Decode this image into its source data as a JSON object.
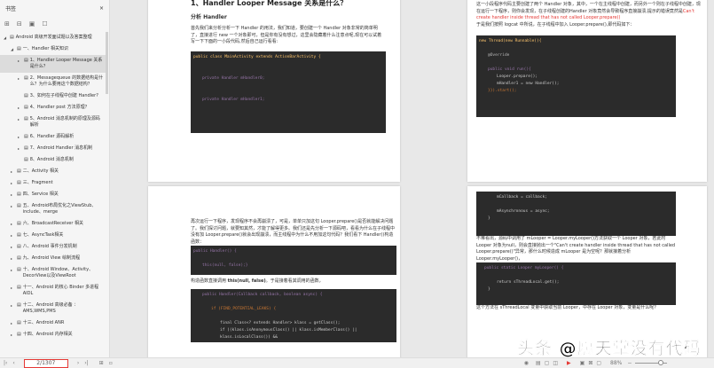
{
  "sidebar": {
    "title": "书签",
    "close": "×",
    "items": [
      {
        "label": "Android 高级开发面试题以及答案整理",
        "level": 0,
        "arrow": "◢"
      },
      {
        "label": "一、Handler 相关知识",
        "level": 1,
        "arrow": "◢"
      },
      {
        "label": "1、Handler Looper Message 关系是什么？",
        "level": 2,
        "arrow": "▸",
        "selected": true
      },
      {
        "label": "2、Messagequeue 的数据结构是什么？为什么要用这个数据结构？",
        "level": 2,
        "arrow": "▸"
      },
      {
        "label": "3、如何在子线程中创建 Handler?",
        "level": 2,
        "arrow": ""
      },
      {
        "label": "4、Handler post 方法原理？",
        "level": 2,
        "arrow": "▸"
      },
      {
        "label": "5、Android 消息机制的原理及源码解析",
        "level": 2,
        "arrow": "▸"
      },
      {
        "label": "6、Handler 源码解析",
        "level": 2,
        "arrow": "▸"
      },
      {
        "label": "7、Android Handler 消息机制",
        "level": 2,
        "arrow": "▸"
      },
      {
        "label": "8、Android 消息机制",
        "level": 2,
        "arrow": ""
      },
      {
        "label": "二、Activity 相关",
        "level": 1,
        "arrow": "▸"
      },
      {
        "label": "三、Fragment",
        "level": 1,
        "arrow": "▸"
      },
      {
        "label": "四、Service 相关",
        "level": 1,
        "arrow": "▸"
      },
      {
        "label": "五、Android布局优化之ViewStub、include、merge",
        "level": 1,
        "arrow": "▸"
      },
      {
        "label": "六、BroadcastReceiver 相关",
        "level": 1,
        "arrow": "▸"
      },
      {
        "label": "七、AsyncTask相关",
        "level": 1,
        "arrow": "▸"
      },
      {
        "label": "八、Android 事件分发机制",
        "level": 1,
        "arrow": "▸"
      },
      {
        "label": "九、Android View 绘制流程",
        "level": 1,
        "arrow": "▸"
      },
      {
        "label": "十、Android Window、Activity、DecorView以及ViewRoot",
        "level": 1,
        "arrow": "▸"
      },
      {
        "label": "十一、Android 的核心 Binder 多进程 AIDL",
        "level": 1,
        "arrow": "▸"
      },
      {
        "label": "十二、Android 高级必备 ：AMS,WMS,PMS",
        "level": 1,
        "arrow": "▸"
      },
      {
        "label": "十三、Android ANR",
        "level": 1,
        "arrow": "▸"
      },
      {
        "label": "十四、Android 内存相关",
        "level": 1,
        "arrow": "▸"
      }
    ]
  },
  "page1": {
    "title": "1、Handler Looper Message 关系是什么？",
    "subtitle": "分析 Handler",
    "para": "首先我们来分析分析一下 Handler 的用法，我们知道，要创建一个 Handler 对象非常的简单明了，直接进行 new 一个对象即可，但是你有没有想过，这里会隐藏着什么注意点呢,现在可以试着写一下下面的一小段代码,然后自己运行看看:",
    "code": [
      "public class MainActivity extends ActionBarActivity {",
      "private Handler mHandler0;",
      "private Handler mHandler1;"
    ]
  },
  "page2": {
    "para1": "这一小段程序代码主要创建了两个 Handler 对象，其中，一个在主线程中创建，而另外一个则在子线程中创建，现在运行一下程序，则你会发现，在子线程创建的Handler 对象竟然会导致程序直接崩溃,提示的错误竟然是",
    "error": "Can't create handler inside thread that has not called Looper.prepare()",
    "para2": "于是我们按照 logcat 中所说，在子线程中加入 Looper.prepare(),即代码如下：",
    "code": [
      "new Thread(new Runnable(){",
      "@Override",
      "public void run(){",
      "Looper.prepare();",
      "mHandler1 = new Handler();",
      "}}).start();"
    ]
  },
  "page3": {
    "para": "再次运行一下程序，发现程序不会再崩溃了，可是，单单只加这句 Looper.prepare()是否就能解决问题了。我们探讨问题，就要知其然，才能了解得更多。我们还是先分析一下源码吧，看看为什么在子线程中没有加 Looper.prepare()就会出现崩溃，而主线程中为什么不用加这句代码？我们看下 Handler()构造函数：",
    "code1": [
      "public Handler() {",
      "this(null, false);}"
    ],
    "para2a": "构造函数直接调用 ",
    "para2b": "this(null, false)",
    "para2c": "。于是接着看其调用的函数，",
    "code2": [
      "public Handler(Callback callback, boolean async) {",
      "if (FIND_POTENTIAL_LEAKS) {",
      "final Class<? extends Handler> klass = getClass();",
      "if ((klass.isAnonymousClass() || klass.isMemberClass() || klass.isLocalClass()) &&"
    ]
  },
  "page4": {
    "code1": [
      "mCallback = callback;",
      "mAsynchronous = async;",
      "}"
    ],
    "para": "不难看出，源码中调用了 mLooper = Looper.myLooper()方法获取一个 Looper 对象，若此时 Looper 对象为null，则会直接抛出一个\"Can't create handler inside thread that has not called Looper.prepare()\"异常，那什么时候造成 mLooper 是为空呢？那就接着分析 Looper.myLooper()，",
    "code2": [
      "public static Looper myLooper() {",
      "return sThreadLocal.get();",
      "}"
    ],
    "para2": "这个方法在 sThreadLocal 变量中获取当前 Looper，中存在 Looper 对象，变量是什么呢？"
  },
  "status": {
    "page": "2/1307",
    "zoom": "88%"
  },
  "watermark": "头条 @愿天堂没有代码",
  "colors": {
    "accent": "#e53935",
    "code_bg": "#2b2b2b"
  }
}
